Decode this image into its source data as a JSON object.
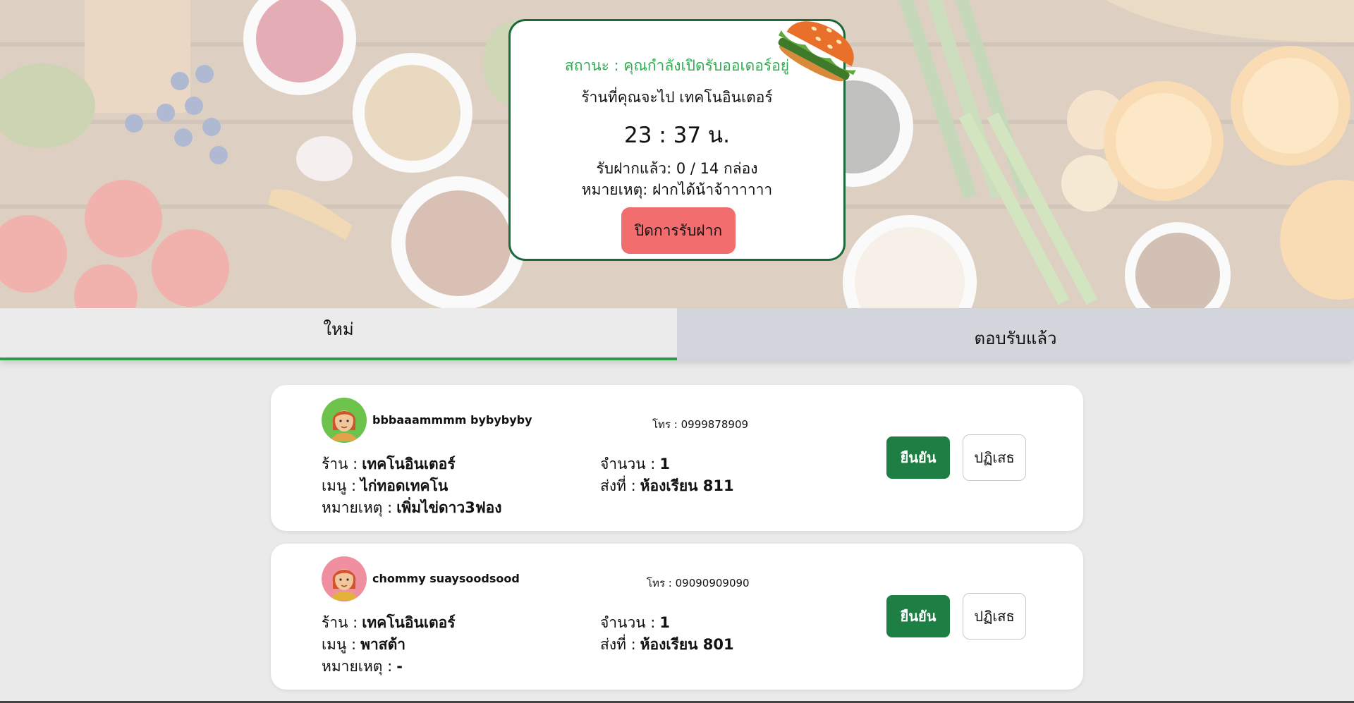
{
  "status": {
    "status_text": "สถานะ : คุณกำลังเปิดรับออเดอร์อยู่",
    "store_text": "ร้านที่คุณจะไป เทคโนอินเตอร์",
    "time_text": "23 : 37 น.",
    "count_text": "รับฝากแล้ว: 0 / 14 กล่อง",
    "note_text": "หมายเหตุ: ฝากได้น้าจ้าาาาาา",
    "close_button": "ปิดการรับฝาก"
  },
  "tabs": {
    "new": "ใหม่",
    "accepted": "ตอบรับแล้ว"
  },
  "labels": {
    "store": "ร้าน :",
    "menu": "เมนู :",
    "note": "หมายเหตุ :",
    "quantity": "จำนวน :",
    "deliver_to": "ส่งที่ :",
    "phone_prefix": "โทร :",
    "confirm": "ยืนยัน",
    "reject": "ปฏิเสธ"
  },
  "orders": [
    {
      "name": "bbbaaammmm bybybyby",
      "phone": "0999878909",
      "store": "เทคโนอินเตอร์",
      "menu": "ไก่ทอดเทคโน",
      "note": "เพิ่มไข่ดาว3ฟอง",
      "quantity": "1",
      "deliver_to": "ห้องเรียน 811",
      "avatar_bg": "#6cc24a"
    },
    {
      "name": "chommy suaysoodsood",
      "phone": "09090909090",
      "store": "เทคโนอินเตอร์",
      "menu": "พาสต้า",
      "note": "-",
      "quantity": "1",
      "deliver_to": "ห้องเรียน 801",
      "avatar_bg": "#f08fa0"
    }
  ],
  "colors": {
    "accent_green": "#1d7f43",
    "status_green": "#2eae4f",
    "close_red": "#f26d6d",
    "tab_underline": "#2d9b4a"
  }
}
